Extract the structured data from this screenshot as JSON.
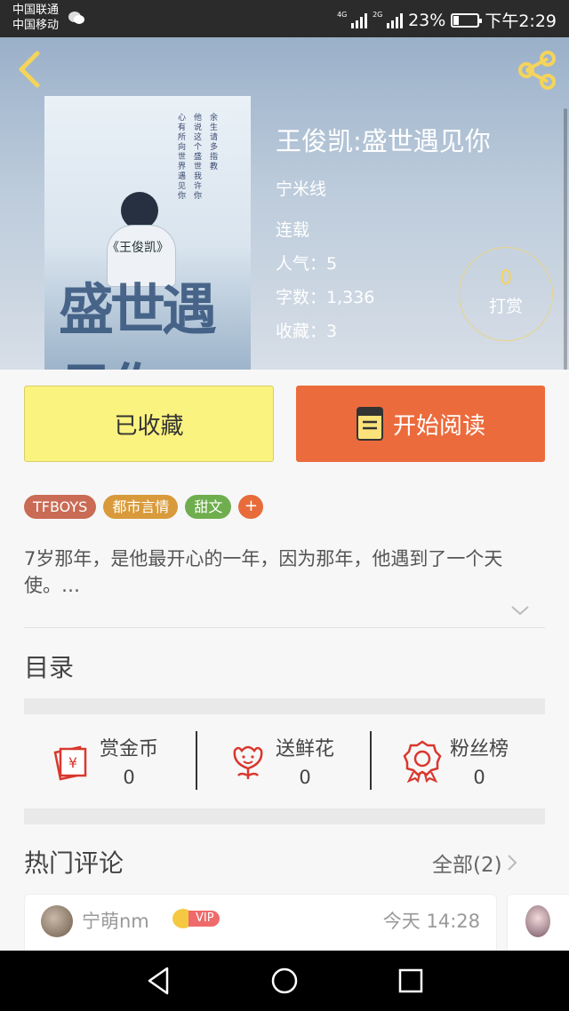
{
  "status_bar": {
    "carrier1": "中国联通",
    "carrier2": "中国移动",
    "net1": "4G",
    "net2": "2G",
    "battery": "23%",
    "time": "下午2:29"
  },
  "book": {
    "title": "王俊凯:盛世遇见你",
    "author": "宁米线",
    "status": "连载",
    "popularity": "人气：5",
    "word_count": "字数：1,336",
    "favorites": "收藏：3",
    "reward_count": "0",
    "reward_label": "打赏"
  },
  "cover": {
    "small_title": "《王俊凯》",
    "big_title": "盛世遇见你"
  },
  "buttons": {
    "collected": "已收藏",
    "start_reading": "开始阅读"
  },
  "tags": [
    "TFBOYS",
    "都市言情",
    "甜文"
  ],
  "tag_colors": [
    "#c96b55",
    "#d89a3a",
    "#6fae4e"
  ],
  "tag_plus": "+",
  "description": "7岁那年，是他最开心的一年，因为那年，他遇到了一个天使。…",
  "toc_label": "目录",
  "actions": [
    {
      "label": "赏金币",
      "value": "0",
      "icon": "coin-envelope-icon"
    },
    {
      "label": "送鲜花",
      "value": "0",
      "icon": "flower-icon"
    },
    {
      "label": "粉丝榜",
      "value": "0",
      "icon": "medal-icon"
    }
  ],
  "comments_section": {
    "title": "热门评论",
    "all_link": "全部(2)",
    "first": {
      "username": "宁萌nm",
      "badge": "VIP",
      "time": "今天 14:28"
    }
  },
  "colors": {
    "accent_orange": "#ec6b3d",
    "collected_yellow": "#fbf37f",
    "icon_red": "#d9382e",
    "header_yellow": "#f5d45a"
  }
}
